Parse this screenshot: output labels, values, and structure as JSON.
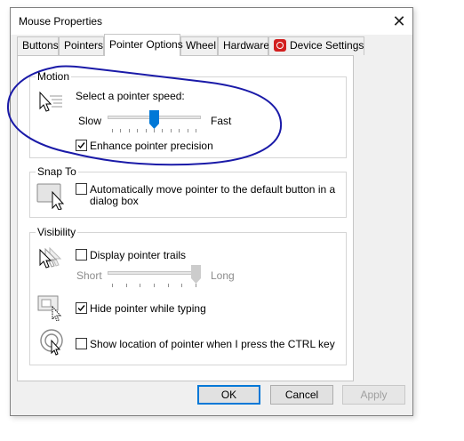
{
  "window": {
    "title": "Mouse Properties"
  },
  "tabs": [
    {
      "label": "Buttons"
    },
    {
      "label": "Pointers"
    },
    {
      "label": "Pointer Options",
      "active": true
    },
    {
      "label": "Wheel"
    },
    {
      "label": "Hardware"
    },
    {
      "label": "Device Settings",
      "icon": "synaptics-icon"
    }
  ],
  "motion": {
    "group_label": "Motion",
    "speed_label": "Select a pointer speed:",
    "slow_label": "Slow",
    "fast_label": "Fast",
    "speed_level": 0.5,
    "enhance_precision": {
      "label": "Enhance pointer precision",
      "checked": true
    }
  },
  "snap_to": {
    "group_label": "Snap To",
    "auto_move": {
      "label_line1": "Automatically move pointer to the default button in a",
      "label_line2": "dialog box",
      "checked": false
    }
  },
  "visibility": {
    "group_label": "Visibility",
    "trails": {
      "label": "Display pointer trails",
      "checked": false
    },
    "short_label": "Short",
    "long_label": "Long",
    "trail_length_level": 1.0,
    "hide_while_typing": {
      "label": "Hide pointer while typing",
      "checked": true
    },
    "show_location": {
      "label": "Show location of pointer when I press the CTRL key",
      "checked": false
    }
  },
  "buttons": {
    "ok": "OK",
    "cancel": "Cancel",
    "apply": "Apply"
  },
  "annotation": {
    "color": "#1a1aa8"
  },
  "colors": {
    "accent": "#0078d7"
  }
}
